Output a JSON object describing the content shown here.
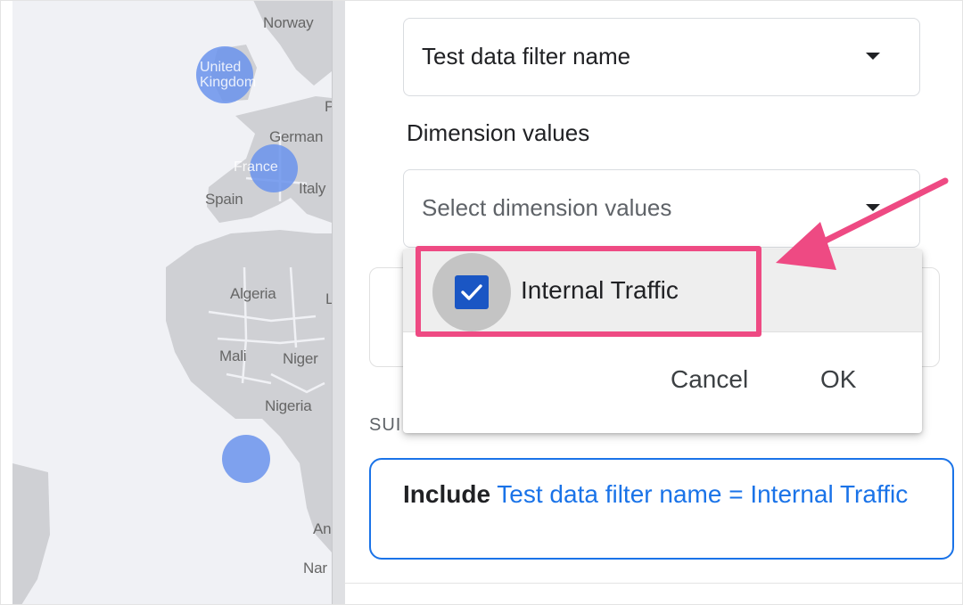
{
  "map": {
    "country_labels": [
      {
        "id": "norway",
        "text": "Norway"
      },
      {
        "id": "germany",
        "text": "German"
      },
      {
        "id": "italy",
        "text": "Italy"
      },
      {
        "id": "spain",
        "text": "Spain"
      },
      {
        "id": "algeria",
        "text": "Algeria"
      },
      {
        "id": "mali",
        "text": "Mali"
      },
      {
        "id": "niger",
        "text": "Niger"
      },
      {
        "id": "nigeria",
        "text": "Nigeria"
      },
      {
        "id": "partial-l",
        "text": "L"
      },
      {
        "id": "partial-p",
        "text": "P"
      },
      {
        "id": "partial-an",
        "text": "An"
      },
      {
        "id": "partial-nar",
        "text": "Nar"
      }
    ],
    "bubbles": [
      {
        "id": "uk",
        "line1": "United",
        "line2": "Kingdom"
      },
      {
        "id": "france",
        "line1": "France",
        "line2": ""
      },
      {
        "id": "africa-west",
        "line1": "",
        "line2": ""
      }
    ],
    "bubble_color": "#6a93ec"
  },
  "filter_select": {
    "value": "Test data filter name"
  },
  "dimension_label": "Dimension values",
  "values_select": {
    "placeholder": "Select dimension values"
  },
  "dropdown": {
    "options": [
      {
        "label": "Internal Traffic",
        "checked": true
      }
    ],
    "cancel_label": "Cancel",
    "ok_label": "OK"
  },
  "summary": {
    "heading": "SUI",
    "keyword": "Include",
    "condition": "Test data filter name = Internal Traffic"
  },
  "colors": {
    "accent": "#1a73e8",
    "checkbox": "#1a56c4",
    "highlight": "#ee4a83"
  }
}
